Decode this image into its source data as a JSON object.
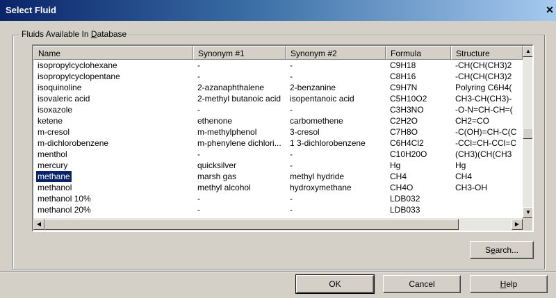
{
  "window": {
    "title": "Select Fluid"
  },
  "group": {
    "label_prefix": "Fluids Available In ",
    "label_accel": "D",
    "label_suffix": "atabase"
  },
  "columns": [
    "Name",
    "Synonym #1",
    "Synonym #2",
    "Formula",
    "Structure"
  ],
  "rows": [
    [
      "isopropylcyclohexane",
      "-",
      "-",
      "C9H18",
      "-CH(CH(CH3)2"
    ],
    [
      "isopropylcyclopentane",
      "-",
      "-",
      "C8H16",
      "-CH(CH(CH3)2"
    ],
    [
      "isoquinoline",
      "2-azanaphthalene",
      "2-benzanine",
      "C9H7N",
      "Polyring C6H4("
    ],
    [
      "isovaleric acid",
      "2-methyl butanoic acid",
      "isopentanoic acid",
      "C5H10O2",
      "CH3-CH(CH3)-"
    ],
    [
      "isoxazole",
      "-",
      "-",
      "C3H3NO",
      "-O-N=CH-CH=("
    ],
    [
      "ketene",
      "ethenone",
      "carbomethene",
      "C2H2O",
      "CH2=CO"
    ],
    [
      "m-cresol",
      "m-methylphenol",
      "3-cresol",
      "C7H8O",
      "-C(OH)=CH-C(C"
    ],
    [
      "m-dichlorobenzene",
      "m-phenylene dichlori...",
      "1 3-dichlorobenzene",
      "C6H4Cl2",
      "-CCl=CH-CCl=C"
    ],
    [
      "menthol",
      "-",
      "-",
      "C10H20O",
      "(CH3)(CH(CH3"
    ],
    [
      "mercury",
      "quicksilver",
      "-",
      "Hg",
      "Hg"
    ],
    [
      "methane",
      "marsh gas",
      "methyl hydride",
      "CH4",
      "CH4"
    ],
    [
      "methanol",
      "methyl alcohol",
      "hydroxymethane",
      "CH4O",
      "CH3-OH"
    ],
    [
      "methanol 10%",
      "-",
      "-",
      "LDB032",
      ""
    ],
    [
      "methanol 20%",
      "-",
      "-",
      "LDB033",
      ""
    ]
  ],
  "selected_row": 10,
  "buttons": {
    "search_accel": "e",
    "search_pre": "S",
    "search_post": "arch...",
    "ok": "OK",
    "cancel": "Cancel",
    "help_accel": "H",
    "help_post": "elp"
  }
}
